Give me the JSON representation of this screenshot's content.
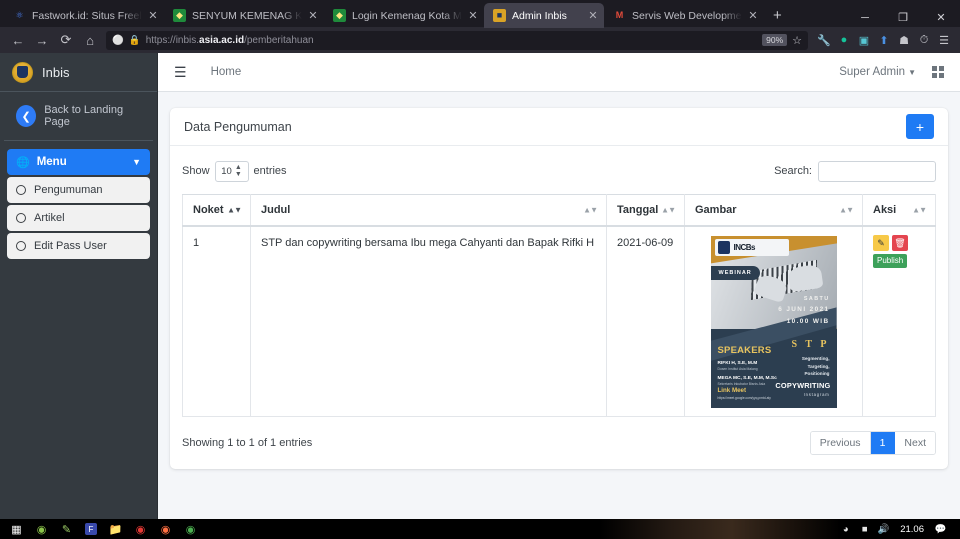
{
  "browser": {
    "tabs": [
      {
        "label": "Fastwork.id: Situs Freelance On",
        "favicon": "fastwork-icon",
        "active": false
      },
      {
        "label": "SENYUM KEMENAG KOTA MAL",
        "favicon": "kemenag-icon",
        "active": false
      },
      {
        "label": "Login Kemenag Kota Malang",
        "favicon": "kemenag-icon",
        "active": false
      },
      {
        "label": "Admin Inbis",
        "favicon": "inbis-icon",
        "active": true
      },
      {
        "label": "Servis Web Development yang m",
        "favicon": "gmail-icon",
        "active": false
      }
    ],
    "new_tab_label": "+",
    "window_controls": {
      "minimize": "─",
      "maximize": "❐",
      "close": "✕"
    },
    "nav": {
      "back": "←",
      "forward": "→",
      "reload": "⟳",
      "home": "⌂"
    },
    "url": {
      "scheme": "https://inbis.",
      "domain": "asia.ac.id",
      "path": "/pemberitahuan"
    },
    "zoom_level": "90%",
    "toolbar_icons": [
      "shield-icon",
      "lock-icon",
      "bookmark-star-icon",
      "wrench-icon",
      "grammarly-icon",
      "notion-icon",
      "updown-icon",
      "pocket-icon",
      "history-icon",
      "app-menu-icon"
    ]
  },
  "sidebar": {
    "brand": "Inbis",
    "back_label": "Back to Landing Page",
    "menu_label": "Menu",
    "items": [
      {
        "label": "Pengumuman"
      },
      {
        "label": "Artikel"
      },
      {
        "label": "Edit Pass User"
      }
    ]
  },
  "topnav": {
    "home_label": "Home",
    "user_label": "Super Admin"
  },
  "page": {
    "card_title": "Data Pengumuman",
    "add_button_label": "+",
    "show_label": "Show",
    "entries_label": "entries",
    "page_length": "10",
    "search_label": "Search:",
    "search_value": "",
    "search_placeholder": "",
    "columns": [
      {
        "label": "Noket",
        "sorted": true
      },
      {
        "label": "Judul",
        "sorted": false
      },
      {
        "label": "Tanggal",
        "sorted": false
      },
      {
        "label": "Gambar",
        "sorted": false
      },
      {
        "label": "Aksi",
        "sorted": false
      }
    ],
    "rows": [
      {
        "noket": "1",
        "judul": "STP dan copywriting bersama Ibu mega Cahyanti dan Bapak Rifki H",
        "tanggal": "2021-06-09",
        "actions": {
          "edit": "✎",
          "delete": "Ὕ1",
          "publish": "Publish"
        }
      }
    ],
    "poster": {
      "org_short": "INCBs",
      "badge": "WEBINAR",
      "day": "SABTU",
      "date": "6 JUNI 2021",
      "time": "10.00 WIB",
      "speakers_heading": "SPEAKERS",
      "speaker1_name": "RIFKI H, S.E, M.M",
      "speaker1_role": "Dosen Institut Asia Malang",
      "speaker2_name": "MEGA MC, S.E, M.M, M.Sc",
      "speaker2_role": "Sekretaris Inkubator Bisnis Asia",
      "link_heading": "Link Meet",
      "link_url": "https://meet.google.com/yyq-pmtd-aty",
      "stp": "S T P",
      "stp_sub_1": "Segmenting,",
      "stp_sub_2": "Targeting,",
      "stp_sub_3": "Positioning",
      "copywriting": "COPYWRITING",
      "instagram": "Instagram"
    },
    "footer_info": "Showing 1 to 1 of 1 entries",
    "pagination": {
      "previous": "Previous",
      "current": "1",
      "next": "Next"
    }
  },
  "taskbar": {
    "icons": [
      "start-icon",
      "android-icon",
      "snipping-icon",
      "flipboard-icon",
      "file-explorer-icon",
      "opera-icon",
      "firefox-icon",
      "chrome-icon"
    ],
    "tray": [
      "chevron-up-icon",
      "wifi-icon",
      "battery-icon",
      "volume-icon"
    ],
    "time": "21.06",
    "notification": "notification-icon"
  },
  "colors": {
    "accent": "#1f7bf4",
    "sidebar": "#343a40",
    "edit": "#f7c948",
    "delete": "#e4454f",
    "publish": "#3da15a"
  }
}
